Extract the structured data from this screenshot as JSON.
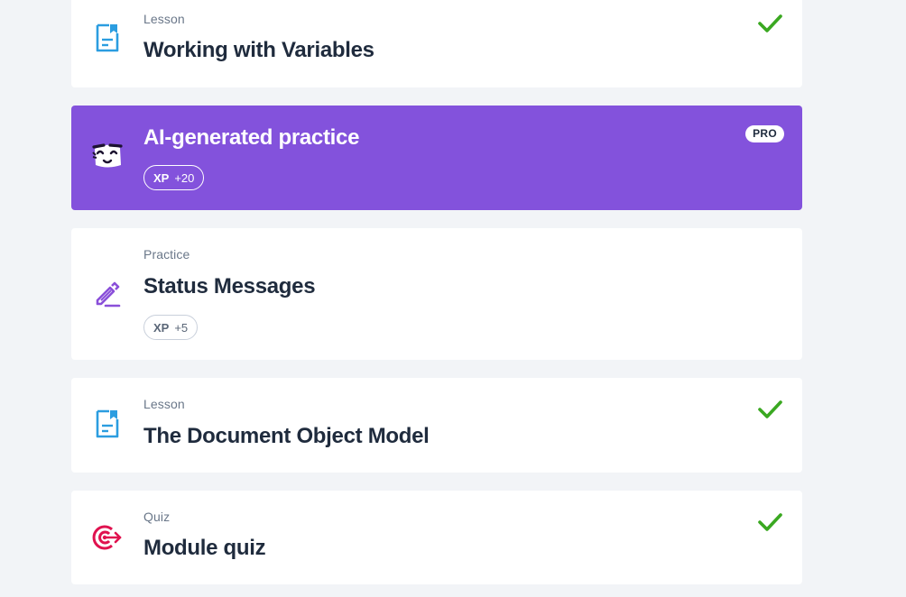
{
  "items": [
    {
      "kind": "Lesson",
      "title": "Working with Variables",
      "icon": "lesson-doc-icon",
      "completed": true
    },
    {
      "title": "AI-generated practice",
      "icon": "ai-mascot-icon",
      "badge": "PRO",
      "xp_label": "XP",
      "xp_value": "+20"
    },
    {
      "kind": "Practice",
      "title": "Status Messages",
      "icon": "pencil-icon",
      "xp_label": "XP",
      "xp_value": "+5"
    },
    {
      "kind": "Lesson",
      "title": "The Document Object Model",
      "icon": "lesson-doc-icon",
      "completed": true
    },
    {
      "kind": "Quiz",
      "title": "Module quiz",
      "icon": "target-icon",
      "completed": true
    }
  ],
  "colors": {
    "background": "#f2f4f7",
    "ai_card": "#8352dc",
    "check": "#3aa821",
    "lesson_icon": "#2b9de0",
    "practice_icon": "#8a4fd9",
    "quiz_icon": "#e0124f",
    "title_text": "#1f2b3d",
    "kind_text": "#6a7789"
  }
}
